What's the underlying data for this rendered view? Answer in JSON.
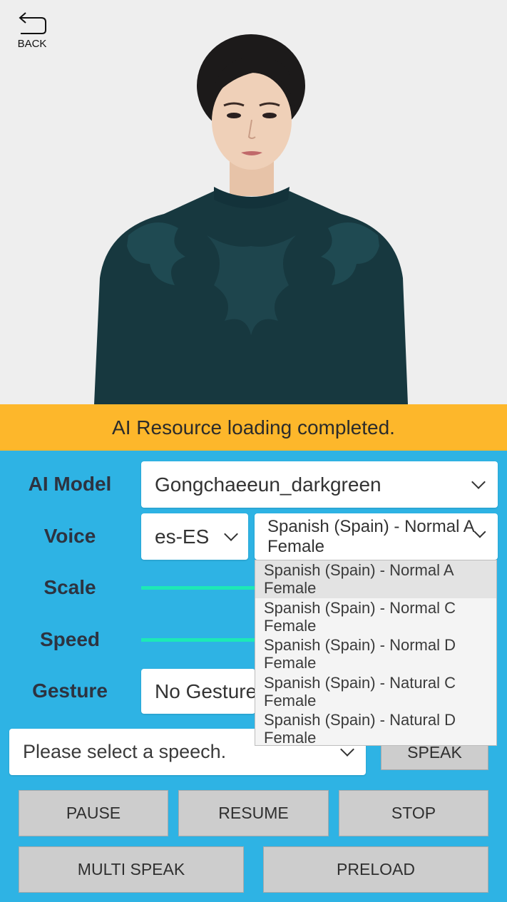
{
  "header": {
    "back_label": "BACK"
  },
  "status": {
    "message": "AI Resource loading completed."
  },
  "controls": {
    "ai_model": {
      "label": "AI Model",
      "value": "Gongchaeeun_darkgreen"
    },
    "voice": {
      "label": "Voice",
      "language": "es-ES",
      "selected": "Spanish (Spain) - Normal A",
      "selected_line2": "Female",
      "options": [
        {
          "line1": "Spanish (Spain) - Normal A",
          "line2": "Female"
        },
        {
          "line1": "Spanish (Spain) - Normal C",
          "line2": "Female"
        },
        {
          "line1": "Spanish (Spain) - Normal D",
          "line2": "Female"
        },
        {
          "line1": "Spanish (Spain) - Natural C",
          "line2": "Female"
        },
        {
          "line1": "Spanish (Spain) - Natural D",
          "line2": "Female"
        }
      ]
    },
    "scale": {
      "label": "Scale"
    },
    "speed": {
      "label": "Speed"
    },
    "gesture": {
      "label": "Gesture",
      "value": "No Gesture"
    },
    "speech": {
      "placeholder": "Please select a speech."
    }
  },
  "buttons": {
    "speak": "SPEAK",
    "pause": "PAUSE",
    "resume": "RESUME",
    "stop": "STOP",
    "multi_speak": "MULTI SPEAK",
    "preload": "PRELOAD"
  },
  "colors": {
    "panel": "#2eb3e4",
    "status_bar": "#fdb72b",
    "slider": "#1de9b6",
    "top_background": "#eeeeee"
  },
  "icons": {
    "back": "back-arrow-icon",
    "dropdown": "chevron-down-icon"
  }
}
